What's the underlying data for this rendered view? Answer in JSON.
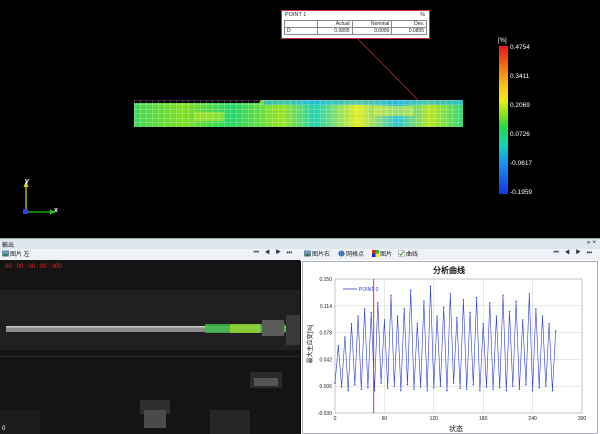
{
  "callout": {
    "title": "POINT 1",
    "unit": "%",
    "headers": [
      "Actual",
      "Nominal",
      "Dev."
    ],
    "row_label": "D",
    "values": [
      "0.0895",
      "0.0000",
      "0.0895"
    ]
  },
  "colorbar": {
    "title": "[%]",
    "labels": [
      "0.4754",
      "0.3411",
      "0.2069",
      "0.0726",
      "-0.0617",
      "-0.1959"
    ]
  },
  "axes3d": {
    "y_label": "y",
    "x_label": "x"
  },
  "panel": {
    "title": "輸出",
    "buttons": "» ×"
  },
  "left_toolbar": {
    "image_left_label": "图片 左",
    "nav": "⏮ ◀ ▶ ⏭"
  },
  "image_view": {
    "timecode": "00 : 00 : 00 : 00 : 000",
    "corner_number": "0"
  },
  "right_toolbar": {
    "items": [
      "图片右",
      "网格点",
      "图片",
      "曲线"
    ],
    "nav": "⏮ ◀ ▶ ⏭"
  },
  "colors": {
    "accent": "#2e3bd6",
    "cursor": "#e02020",
    "callout_border": "#cc3333"
  },
  "chart_data": {
    "type": "line",
    "title": "分析曲线",
    "xlabel": "状态",
    "ylabel": "最大主应变[%]",
    "xlim": [
      0,
      300
    ],
    "ylim": [
      -0.03,
      0.15
    ],
    "xticks": [
      "0",
      "60",
      "120",
      "180",
      "240",
      "300"
    ],
    "yticks": [
      "0.150",
      "0.114",
      "0.078",
      "0.042",
      "0.006",
      "-0.030"
    ],
    "cursor_x": 47,
    "grid": true,
    "legend_position": "top-left",
    "series": [
      {
        "name": "POINT 0",
        "x": [
          0,
          4,
          8,
          12,
          16,
          20,
          24,
          28,
          32,
          36,
          40,
          44,
          48,
          52,
          56,
          60,
          64,
          68,
          72,
          76,
          80,
          84,
          88,
          92,
          96,
          100,
          104,
          108,
          112,
          116,
          120,
          124,
          128,
          132,
          136,
          140,
          144,
          148,
          152,
          156,
          160,
          164,
          168,
          172,
          176,
          180,
          184,
          188,
          192,
          196,
          200,
          204,
          208,
          212,
          216,
          220,
          224,
          228,
          232,
          236,
          240,
          244,
          248,
          252,
          256,
          260,
          264,
          268
        ],
        "y": [
          0.01,
          0.06,
          0.005,
          0.072,
          0.0,
          0.09,
          0.008,
          0.1,
          0.002,
          0.11,
          0.004,
          0.105,
          0.0,
          0.118,
          0.01,
          0.095,
          0.003,
          0.128,
          0.006,
          0.1,
          0.0,
          0.11,
          0.008,
          0.135,
          0.002,
          0.09,
          0.005,
          0.12,
          0.0,
          0.14,
          0.004,
          0.1,
          0.006,
          0.112,
          0.0,
          0.13,
          0.01,
          0.098,
          0.003,
          0.122,
          0.002,
          0.105,
          0.008,
          0.125,
          0.0,
          0.09,
          0.005,
          0.118,
          0.002,
          0.1,
          0.004,
          0.128,
          0.0,
          0.106,
          0.006,
          0.12,
          0.002,
          0.095,
          0.008,
          0.13,
          0.0,
          0.11,
          0.004,
          0.1,
          0.006,
          0.09,
          0.0,
          0.08
        ]
      }
    ]
  }
}
